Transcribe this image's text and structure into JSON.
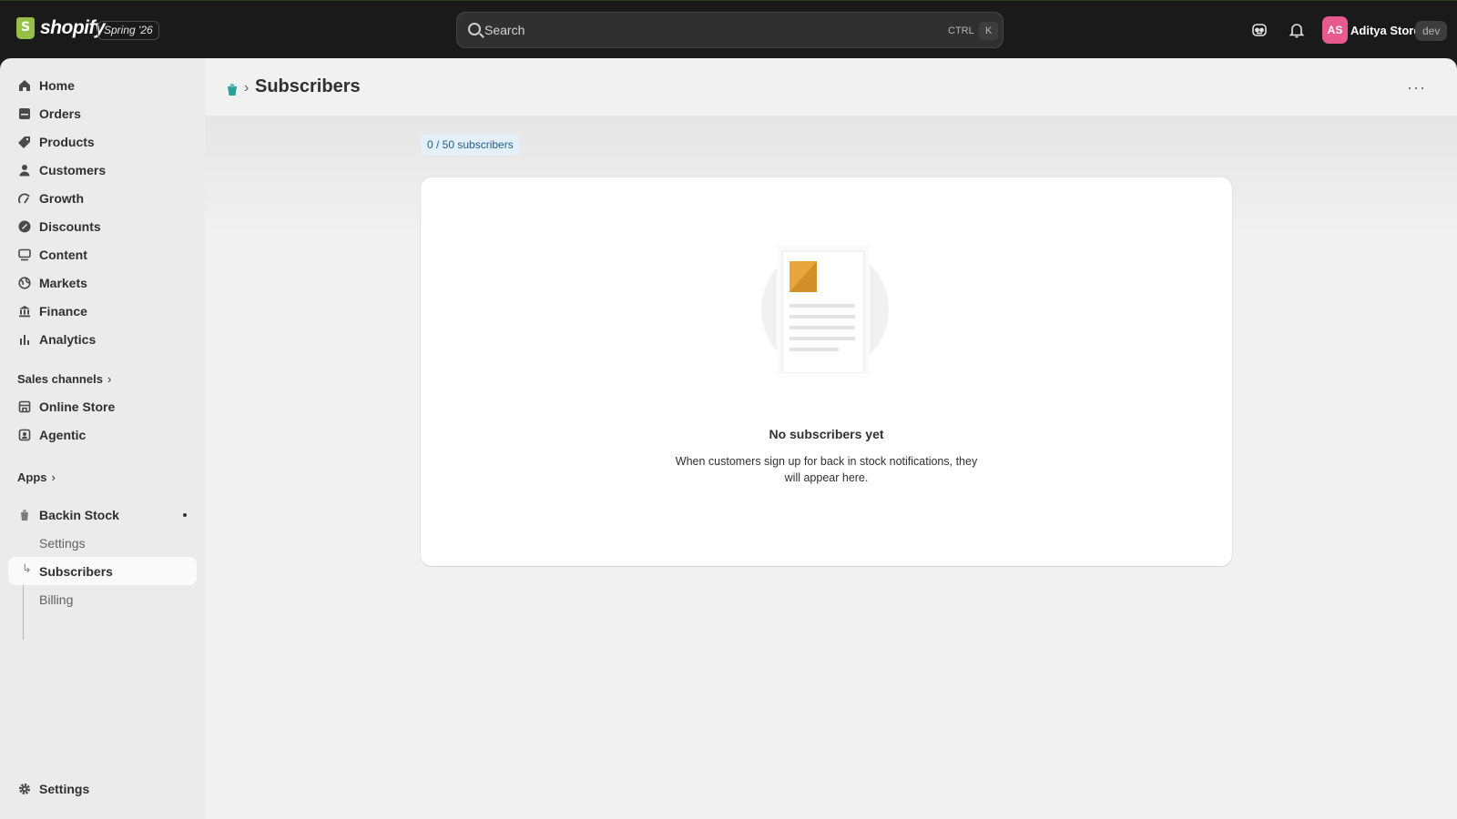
{
  "topbar": {
    "logo_text": "shopify",
    "edition_label": "Spring '26",
    "search_placeholder": "Search",
    "shortcut_ctrl": "CTRL",
    "shortcut_key": "K",
    "avatar_initials": "AS",
    "store_name": "Aditya Store",
    "env_badge": "dev",
    "icons": [
      "sidekick-icon",
      "bell-icon"
    ]
  },
  "sidebar": {
    "items": [
      {
        "label": "Home",
        "icon": "home-icon"
      },
      {
        "label": "Orders",
        "icon": "orders-icon"
      },
      {
        "label": "Products",
        "icon": "tag-icon"
      },
      {
        "label": "Customers",
        "icon": "person-icon"
      },
      {
        "label": "Growth",
        "icon": "growth-icon"
      },
      {
        "label": "Discounts",
        "icon": "discount-icon"
      },
      {
        "label": "Content",
        "icon": "content-icon"
      },
      {
        "label": "Markets",
        "icon": "globe-icon"
      },
      {
        "label": "Finance",
        "icon": "bank-icon"
      },
      {
        "label": "Analytics",
        "icon": "bar-chart-icon"
      }
    ],
    "sales_channels_label": "Sales channels",
    "channels": [
      {
        "label": "Online Store",
        "icon": "store-icon"
      },
      {
        "label": "Agentic",
        "icon": "agentic-icon"
      }
    ],
    "apps_label": "Apps",
    "app": {
      "label": "Backin Stock",
      "icon": "app-icon",
      "subitems": [
        "Settings",
        "Subscribers",
        "Billing"
      ],
      "active": "Subscribers"
    },
    "settings_label": "Settings"
  },
  "main": {
    "page_title": "Subscribers",
    "subscriber_count": "0 / 50 subscribers",
    "empty_title": "No subscribers yet",
    "empty_body": "When customers sign up for back in stock notifications, they will appear here.",
    "more_label": "···"
  },
  "colors": {
    "topbar_bg": "#1a1a1a",
    "sidebar_bg": "#ebebeb",
    "main_bg": "#f1f1f1",
    "accent_badge_bg": "#e3f0fa",
    "avatar_bg": "#e85a8c",
    "illustration_accent": "#e8a53a"
  }
}
